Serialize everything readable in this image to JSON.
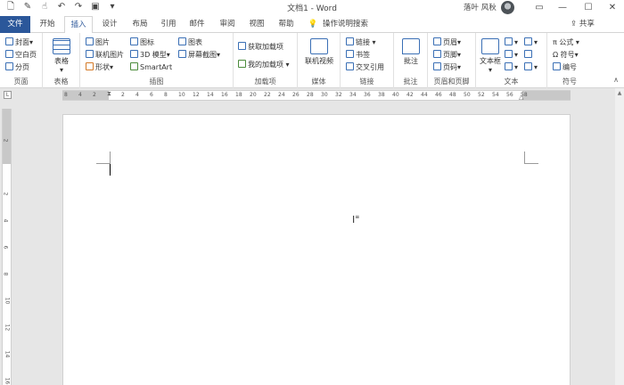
{
  "titlebar": {
    "title": "文档1 - Word",
    "user": "落叶 风秋",
    "min": "—",
    "restore": "☐",
    "close": "✕"
  },
  "tabs": [
    "文件",
    "开始",
    "插入",
    "设计",
    "布局",
    "引用",
    "邮件",
    "审阅",
    "视图",
    "帮助"
  ],
  "tell_me": "操作说明搜索",
  "share": "共享",
  "ribbon": {
    "pages": {
      "cover": "封面",
      "blank": "空白页",
      "break": "分页",
      "label": "页面"
    },
    "table": {
      "btn": "表格",
      "label": "表格"
    },
    "illustrations": {
      "pictures": "图片",
      "online_pictures": "联机图片",
      "shapes": "形状",
      "icons": "图标",
      "models3d": "3D 模型",
      "smartart": "SmartArt",
      "chart": "图表",
      "screenshot": "屏幕截图",
      "label": "插图"
    },
    "addins": {
      "get": "获取加载项",
      "my": "我的加载项",
      "label": "加载项"
    },
    "media": {
      "online_video": "联机视频",
      "label": "媒体"
    },
    "links": {
      "link": "链接",
      "bookmark": "书签",
      "crossref": "交叉引用",
      "label": "链接"
    },
    "comments": {
      "comment": "批注",
      "label": "批注"
    },
    "header_footer": {
      "header": "页眉",
      "footer": "页脚",
      "page_number": "页码",
      "label": "页眉和页脚"
    },
    "text": {
      "textbox": "文本框",
      "label": "文本"
    },
    "symbols": {
      "equation": "公式",
      "symbol": "符号",
      "number": "编号",
      "label": "符号"
    }
  },
  "ruler_h_ticks": [
    "8",
    "4",
    "2",
    "",
    "2",
    "4",
    "6",
    "8",
    "10",
    "12",
    "14",
    "16",
    "18",
    "20",
    "22",
    "24",
    "26",
    "28",
    "30",
    "32",
    "34",
    "36",
    "38",
    "40",
    "42",
    "44",
    "46",
    "48",
    "50",
    "52",
    "54",
    "56",
    "58"
  ],
  "ruler_v_ticks": [
    "2",
    "",
    "2",
    "4",
    "6",
    "8",
    "10",
    "12",
    "14",
    "16"
  ]
}
